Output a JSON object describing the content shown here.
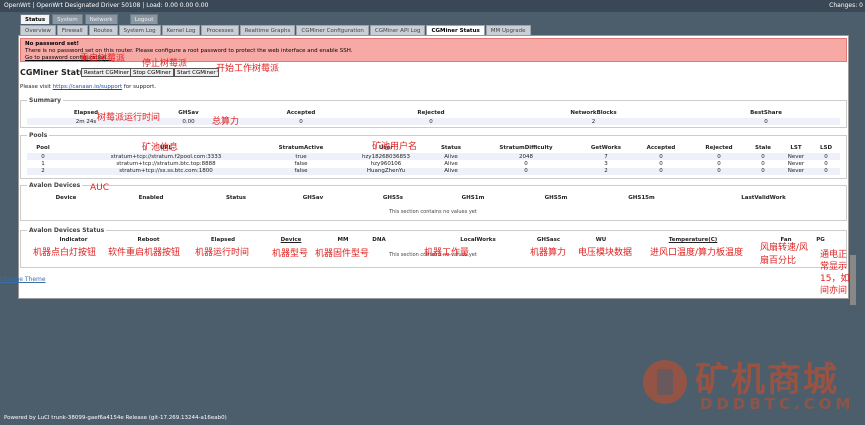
{
  "topbar": {
    "title": "OpenWrt | OpenWrt Designated Driver 50108 | Load: 0.00 0.00 0.00",
    "changes": "Changes: 0"
  },
  "main_tabs": [
    "Status",
    "System",
    "Network",
    "Logout"
  ],
  "sub_tabs": [
    "Overview",
    "Firewall",
    "Routes",
    "System Log",
    "Kernel Log",
    "Processes",
    "Realtime Graphs",
    "CGMiner Configuration",
    "CGMiner API Log",
    "CGMiner Status",
    "MM Upgrade"
  ],
  "alert": {
    "title": "No password set!",
    "text": "There is no password set on this router. Please configure a root password to protect the web interface and enable SSH.",
    "link": "Go to password configuration..."
  },
  "page": {
    "title": "CGMiner Status",
    "restart_btn": "Restart CGMiner",
    "stop_btn": "Stop CGMiner",
    "start_btn": "Start CGMiner",
    "visit_prefix": "Please visit",
    "visit_link": "https://canaan.io/support",
    "visit_suffix": "for support."
  },
  "summary": {
    "legend": "Summary",
    "headers": [
      "Elapsed",
      "GHSav",
      "Accepted",
      "Rejected",
      "NetworkBlocks",
      "BestShare"
    ],
    "values": [
      "2m 24s",
      "0.00",
      "0",
      "0",
      "2",
      "0"
    ]
  },
  "pools": {
    "legend": "Pools",
    "headers": [
      "Pool",
      "URL",
      "StratumActive",
      "User",
      "Status",
      "StratumDifficulty",
      "GetWorks",
      "Accepted",
      "Rejected",
      "Stale",
      "LST",
      "LSD"
    ],
    "rows": [
      [
        "0",
        "stratum+tcp://stratum.f2pool.com:3333",
        "true",
        "hzy18268036853",
        "Alive",
        "2048",
        "7",
        "0",
        "0",
        "0",
        "Never",
        "0"
      ],
      [
        "1",
        "stratum+tcp://stratum.btc.top:8888",
        "false",
        "hzy960106",
        "Alive",
        "0",
        "3",
        "0",
        "0",
        "0",
        "Never",
        "0"
      ],
      [
        "2",
        "stratum+tcp://ss.ss.btc.com:1800",
        "false",
        "HuangZhenYu",
        "Alive",
        "0",
        "2",
        "0",
        "0",
        "0",
        "Never",
        "0"
      ]
    ]
  },
  "avalon_devices": {
    "legend": "Avalon Devices",
    "headers": [
      "Device",
      "Enabled",
      "Status",
      "GHSav",
      "GHS5s",
      "GHS1m",
      "GHS5m",
      "GHS15m",
      "LastValidWork"
    ],
    "empty": "This section contains no values yet"
  },
  "avalon_status": {
    "legend": "Avalon Devices Status",
    "headers": [
      "Indicator",
      "Reboot",
      "Elapsed",
      "Device",
      "MM",
      "DNA",
      "LocalWorks",
      "GHSasc",
      "WU",
      "Temperature(C)",
      "Fan",
      "PG"
    ],
    "empty": "This section contains no values yet"
  },
  "annotations": {
    "restart": "重启树莓派",
    "stop": "停止树莓派",
    "start": "开始工作树莓派",
    "elapsed": "树莓派运行时间",
    "ghsav": "总算力",
    "pool": "矿池信息",
    "user": "矿池用户名",
    "auc": "AUC",
    "indicator": "机器点白灯按钮",
    "reboot": "软件重启机器按钮",
    "elapsed2": "机器运行时间",
    "device": "机器型号",
    "mm": "机器固件型号",
    "localworks": "机器工作量",
    "ghsasc": "机器算力",
    "wu": "电压模块数据",
    "temp": "进风口温度/算力板温度",
    "fan_1": "风扇转速/风",
    "fan_2": "扇百分比",
    "pg_1": "通电正",
    "pg_2": "常显示",
    "pg_3": "15，如",
    "pg_4": "间亦间"
  },
  "change_theme": "Change Theme",
  "footer": "Powered by LuCI trunk-38099-gaef6a4154e Release (git-17.269.13244-a16eab0)",
  "watermark": {
    "name": "矿机商城",
    "domain": "DDDBTC.COM"
  },
  "colors": {
    "background": "#4c5d6c",
    "alert_bg": "#f7a9a6",
    "annotation": "#e02020",
    "brand": "#d94c20"
  }
}
